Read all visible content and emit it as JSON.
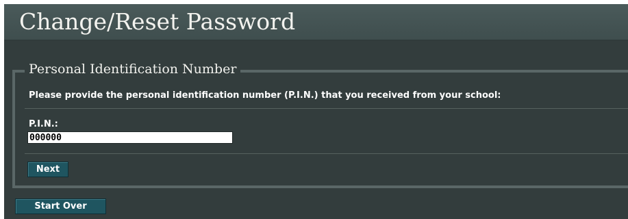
{
  "page": {
    "title": "Change/Reset Password"
  },
  "pin_section": {
    "legend": "Personal Identification Number",
    "instruction": "Please provide the personal identification number (P.I.N.) that you received from your school:",
    "pin_label": "P.I.N.:",
    "pin_value": "000000",
    "next_label": "Next"
  },
  "footer": {
    "start_over_label": "Start Over"
  },
  "colors": {
    "header_bg": "#4a5a5a",
    "content_bg": "#333d3d",
    "button_bg": "#1f5560",
    "text": "#ffffff"
  }
}
